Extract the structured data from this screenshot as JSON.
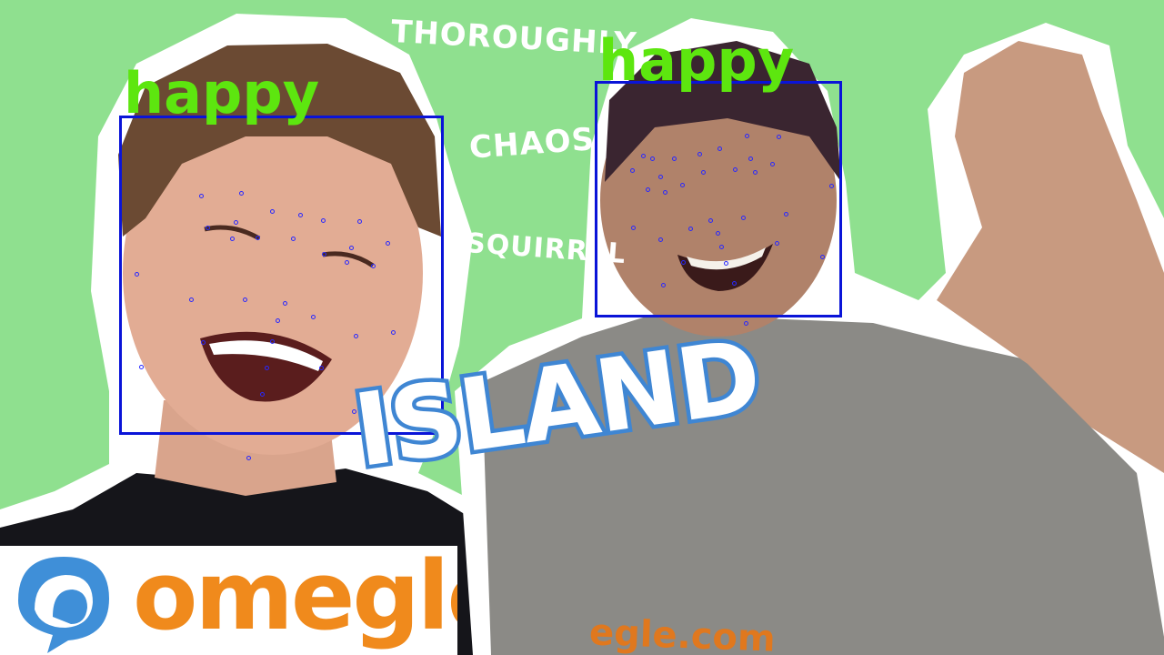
{
  "background_words": [
    "THOROUGHLY",
    "CHAOS",
    "SQUIRREL"
  ],
  "faces": [
    {
      "emotion": "happy"
    },
    {
      "emotion": "happy"
    }
  ],
  "title_word": "ISLAND",
  "logo": {
    "text": "omegle"
  },
  "shirt_print": "egle.com",
  "colors": {
    "background": "#8fe08f",
    "face_box": "#0a14d8",
    "emotion_label": "#5de60f",
    "landmark": "#2828ff",
    "title_fill": "#ffffff",
    "title_outline": "#3f86d3",
    "logo_blue": "#3f8fd8",
    "logo_orange": "#f08a1c"
  }
}
